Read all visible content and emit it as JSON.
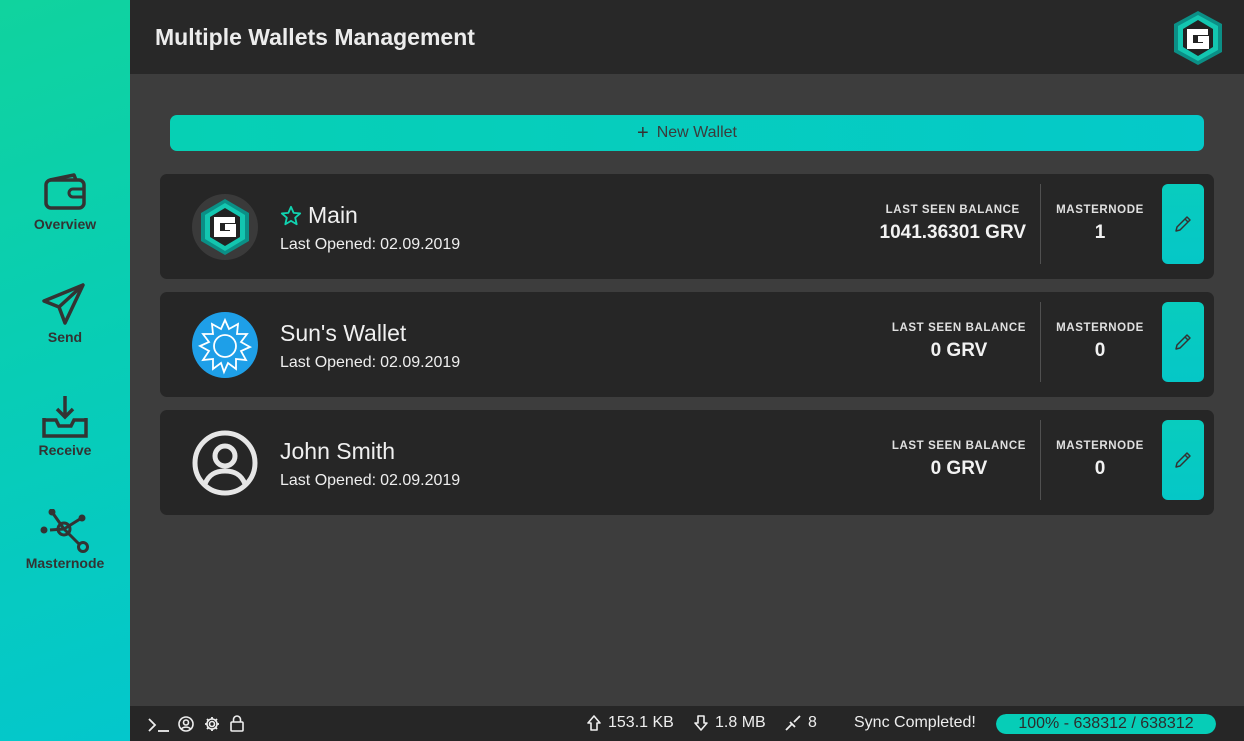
{
  "sidebar": {
    "items": [
      {
        "label": "Overview",
        "icon": "wallet-icon"
      },
      {
        "label": "Send",
        "icon": "paper-plane-icon"
      },
      {
        "label": "Receive",
        "icon": "inbox-download-icon"
      },
      {
        "label": "Masternode",
        "icon": "network-nodes-icon"
      }
    ]
  },
  "header": {
    "title": "Multiple Wallets Management",
    "logo_icon": "grv-logo-icon"
  },
  "actions": {
    "new_wallet_label": "New Wallet"
  },
  "wallets": [
    {
      "name": "Main",
      "favorite": true,
      "opened_label": "Last Opened:",
      "opened_date": "02.09.2019",
      "balance_label": "LAST SEEN BALANCE",
      "balance": "1041.36301 GRV",
      "masternode_label": "MASTERNODE",
      "masternode": "1",
      "avatar": "grv-logo-icon"
    },
    {
      "name": "Sun's Wallet",
      "favorite": false,
      "opened_label": "Last Opened:",
      "opened_date": "02.09.2019",
      "balance_label": "LAST SEEN BALANCE",
      "balance": "0 GRV",
      "masternode_label": "MASTERNODE",
      "masternode": "0",
      "avatar": "sun-icon"
    },
    {
      "name": "John Smith",
      "favorite": false,
      "opened_label": "Last Opened:",
      "opened_date": "02.09.2019",
      "balance_label": "LAST SEEN BALANCE",
      "balance": "0 GRV",
      "masternode_label": "MASTERNODE",
      "masternode": "0",
      "avatar": "user-circle-icon"
    }
  ],
  "status": {
    "upload": "153.1 KB",
    "download": "1.8 MB",
    "peers": "8",
    "sync_text": "Sync Completed!",
    "progress_text": "100% - 638312 / 638312",
    "progress_fraction": 1.0
  },
  "colors": {
    "accent": "#05c9c9",
    "accent_green": "#10d39e",
    "panel": "#262626",
    "background": "#3d3d3d"
  }
}
